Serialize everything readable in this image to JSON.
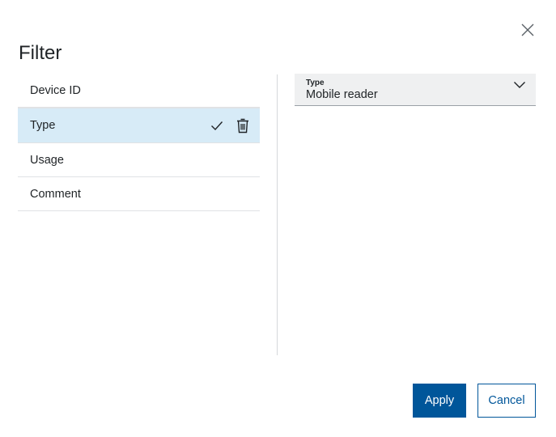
{
  "dialog": {
    "title": "Filter",
    "close_icon": "close-icon"
  },
  "filters": {
    "items": [
      {
        "label": "Device ID",
        "selected": false
      },
      {
        "label": "Type",
        "selected": true,
        "icons": [
          "check-icon",
          "trash-icon"
        ]
      },
      {
        "label": "Usage",
        "selected": false
      },
      {
        "label": "Comment",
        "selected": false
      }
    ]
  },
  "type_select": {
    "label": "Type",
    "value": "Mobile reader",
    "icon": "chevron-down-icon"
  },
  "actions": {
    "apply_label": "Apply",
    "cancel_label": "Cancel"
  },
  "colors": {
    "primary": "#00569a",
    "selected_row": "#d7ebf7",
    "select_bg": "#eff0f1"
  }
}
